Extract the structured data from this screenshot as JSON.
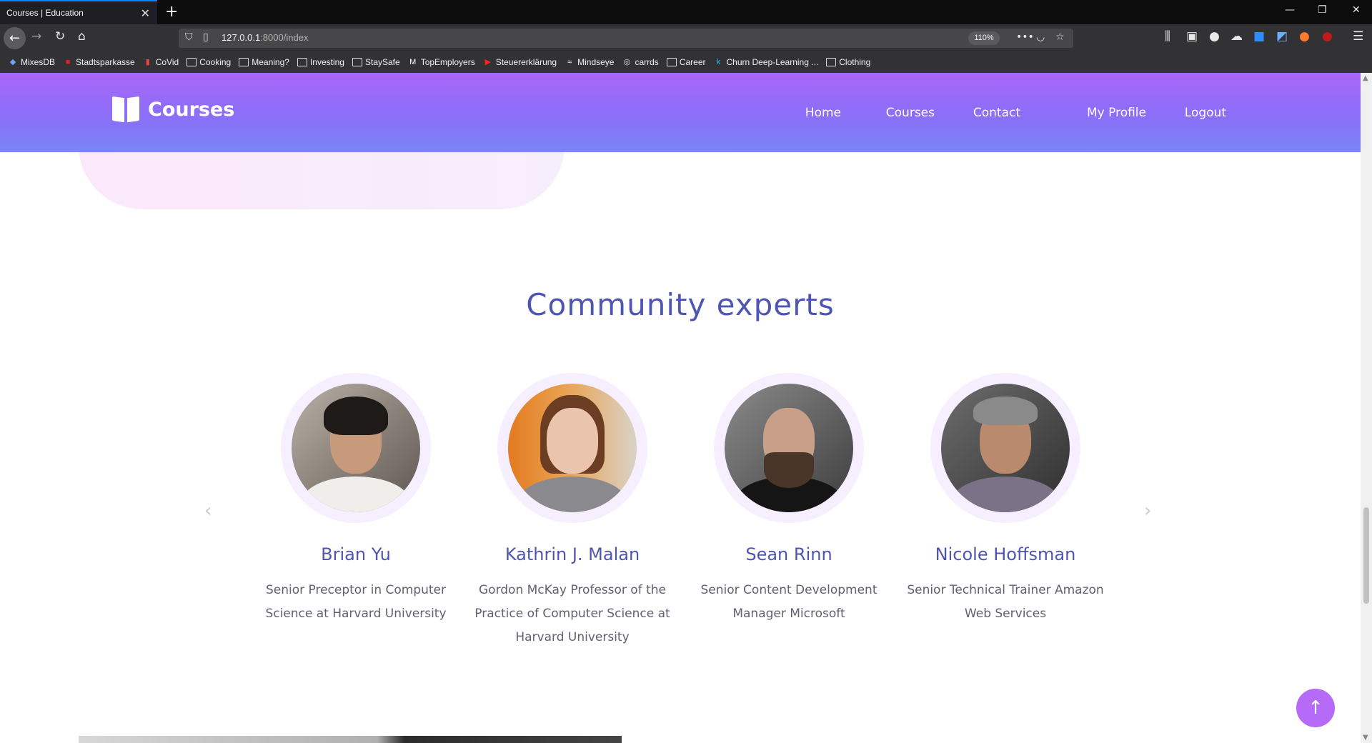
{
  "browser": {
    "tab_title": "Courses | Education",
    "tab_close": "✕",
    "new_tab": "+",
    "url_host": "127.0.0.1",
    "url_path": ":8000/index",
    "zoom": "110%",
    "window_controls": [
      "—",
      "❐",
      "✕"
    ],
    "bookmarks": [
      {
        "label": "MixesDB",
        "icon": "mixesdb-icon"
      },
      {
        "label": "Stadtsparkasse",
        "icon": "bank-icon"
      },
      {
        "label": "CoVid",
        "icon": "covid-icon"
      },
      {
        "label": "Cooking",
        "icon": "folder-icon"
      },
      {
        "label": "Meaning?",
        "icon": "folder-icon"
      },
      {
        "label": "Investing",
        "icon": "folder-icon"
      },
      {
        "label": "StaySafe",
        "icon": "folder-icon"
      },
      {
        "label": "TopEmployers",
        "icon": "medium-icon"
      },
      {
        "label": "Steuererklärung",
        "icon": "youtube-icon"
      },
      {
        "label": "Mindseye",
        "icon": "mindseye-icon"
      },
      {
        "label": "carrds",
        "icon": "globe-icon"
      },
      {
        "label": "Career",
        "icon": "folder-icon"
      },
      {
        "label": "Churn Deep-Learning ...",
        "icon": "kaggle-icon"
      },
      {
        "label": "Clothing",
        "icon": "folder-icon"
      }
    ]
  },
  "site": {
    "logo_text": "Courses",
    "nav": [
      "Home",
      "Courses",
      "Contact",
      "My Profile",
      "Logout"
    ]
  },
  "section": {
    "title": "Community experts",
    "prev_arrow": "‹",
    "next_arrow": "›"
  },
  "experts": [
    {
      "name": "Brian Yu",
      "role": "Senior Preceptor in Computer Science at Harvard University"
    },
    {
      "name": "Kathrin J. Malan",
      "role": "Gordon McKay Professor of the Practice of Computer Science at Harvard University"
    },
    {
      "name": "Sean Rinn",
      "role": "Senior Content Development Manager Microsoft"
    },
    {
      "name": "Nicole Hoffsman",
      "role": "Senior Technical Trainer Amazon Web Services"
    }
  ],
  "back_to_top": "↑"
}
